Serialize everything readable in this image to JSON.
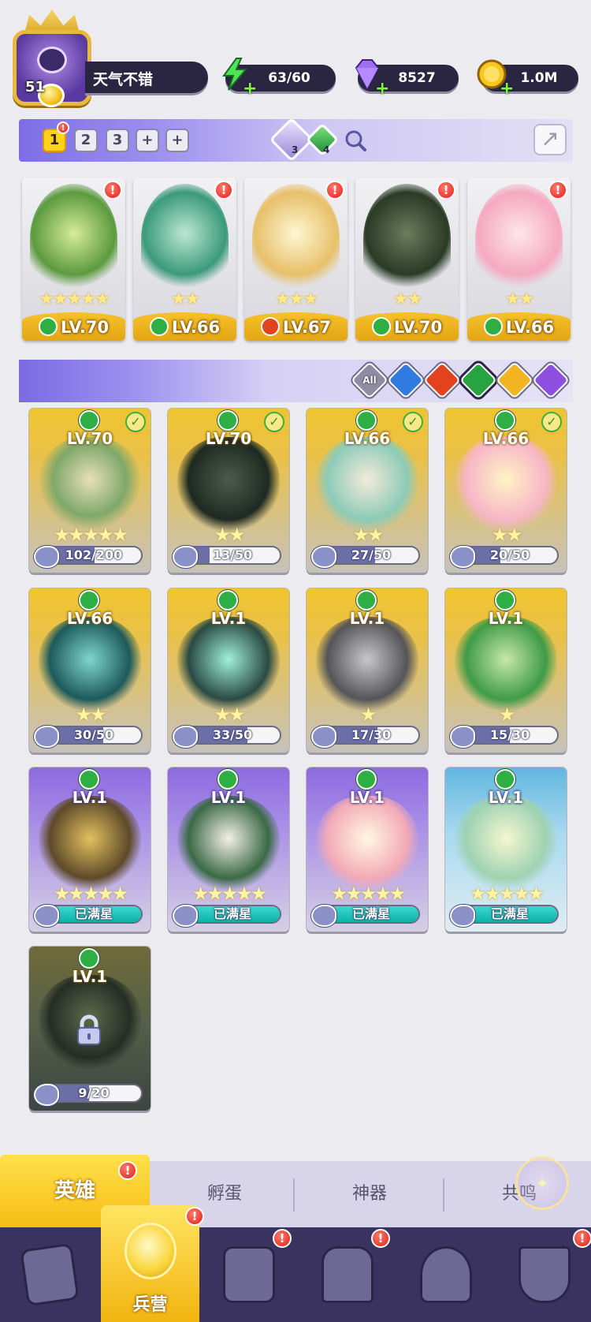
{
  "player": {
    "level": "51",
    "name": "天气不错"
  },
  "resources": {
    "energy": "63/60",
    "gems": "8527",
    "coins": "1.0M"
  },
  "teams": {
    "tabs": [
      "1",
      "2",
      "3",
      "+",
      "+"
    ],
    "active": "1",
    "alert": "!",
    "stone_purple_count": "3",
    "stone_green_count": "4"
  },
  "team_cards": [
    {
      "level": "LV.70",
      "element": "wind",
      "stars": "★★★★★",
      "alert": "!"
    },
    {
      "level": "LV.66",
      "element": "wind",
      "stars": "★★",
      "alert": "!"
    },
    {
      "level": "LV.67",
      "element": "fire",
      "stars": "★★★",
      "alert": "!"
    },
    {
      "level": "LV.70",
      "element": "wind",
      "stars": "★★",
      "alert": "!"
    },
    {
      "level": "LV.66",
      "element": "wind",
      "stars": "★★",
      "alert": "!"
    }
  ],
  "filters": {
    "all": "All",
    "options": [
      "water",
      "fire",
      "wind",
      "light",
      "dark"
    ],
    "selected": "wind"
  },
  "heroes": [
    {
      "level": "LV.70",
      "stars": "★★★★★",
      "shards": "102/200",
      "fraction": 0.51,
      "in_team": true,
      "rarity": "gold"
    },
    {
      "level": "LV.70",
      "stars": "★★",
      "shards": "13/50",
      "fraction": 0.26,
      "in_team": true,
      "rarity": "gold"
    },
    {
      "level": "LV.66",
      "stars": "★★",
      "shards": "27/50",
      "fraction": 0.54,
      "in_team": true,
      "rarity": "gold"
    },
    {
      "level": "LV.66",
      "stars": "★★",
      "shards": "20/50",
      "fraction": 0.4,
      "in_team": true,
      "rarity": "gold"
    },
    {
      "level": "LV.66",
      "stars": "★★",
      "shards": "30/50",
      "fraction": 0.6,
      "in_team": false,
      "rarity": "gold"
    },
    {
      "level": "LV.1",
      "stars": "★★",
      "shards": "33/50",
      "fraction": 0.66,
      "in_team": false,
      "rarity": "gold"
    },
    {
      "level": "LV.1",
      "stars": "★",
      "shards": "17/30",
      "fraction": 0.57,
      "in_team": false,
      "rarity": "gold"
    },
    {
      "level": "LV.1",
      "stars": "★",
      "shards": "15/30",
      "fraction": 0.5,
      "in_team": false,
      "rarity": "gold"
    },
    {
      "level": "LV.1",
      "stars": "★★★★★",
      "shards": "已满星",
      "fraction": 1.0,
      "in_team": false,
      "rarity": "purple"
    },
    {
      "level": "LV.1",
      "stars": "★★★★★",
      "shards": "已满星",
      "fraction": 1.0,
      "in_team": false,
      "rarity": "purple"
    },
    {
      "level": "LV.1",
      "stars": "★★★★★",
      "shards": "已满星",
      "fraction": 1.0,
      "in_team": false,
      "rarity": "purple"
    },
    {
      "level": "LV.1",
      "stars": "★★★★★",
      "shards": "已满星",
      "fraction": 1.0,
      "in_team": false,
      "rarity": "blue"
    },
    {
      "level": "LV.1",
      "stars": "",
      "shards": "9/20",
      "fraction": 0.45,
      "in_team": false,
      "rarity": "dark",
      "locked": true
    }
  ],
  "subtabs": {
    "heroes": "英雄",
    "hatch": "孵蛋",
    "artifacts": "神器",
    "resonance": "共鸣",
    "alert": "!"
  },
  "nav": {
    "barracks": "兵营",
    "alert": "!"
  },
  "colors": {
    "accent_gold": "#f6bd14",
    "team_bar": "#7e6ee6",
    "nav_bg": "#3a3360"
  }
}
